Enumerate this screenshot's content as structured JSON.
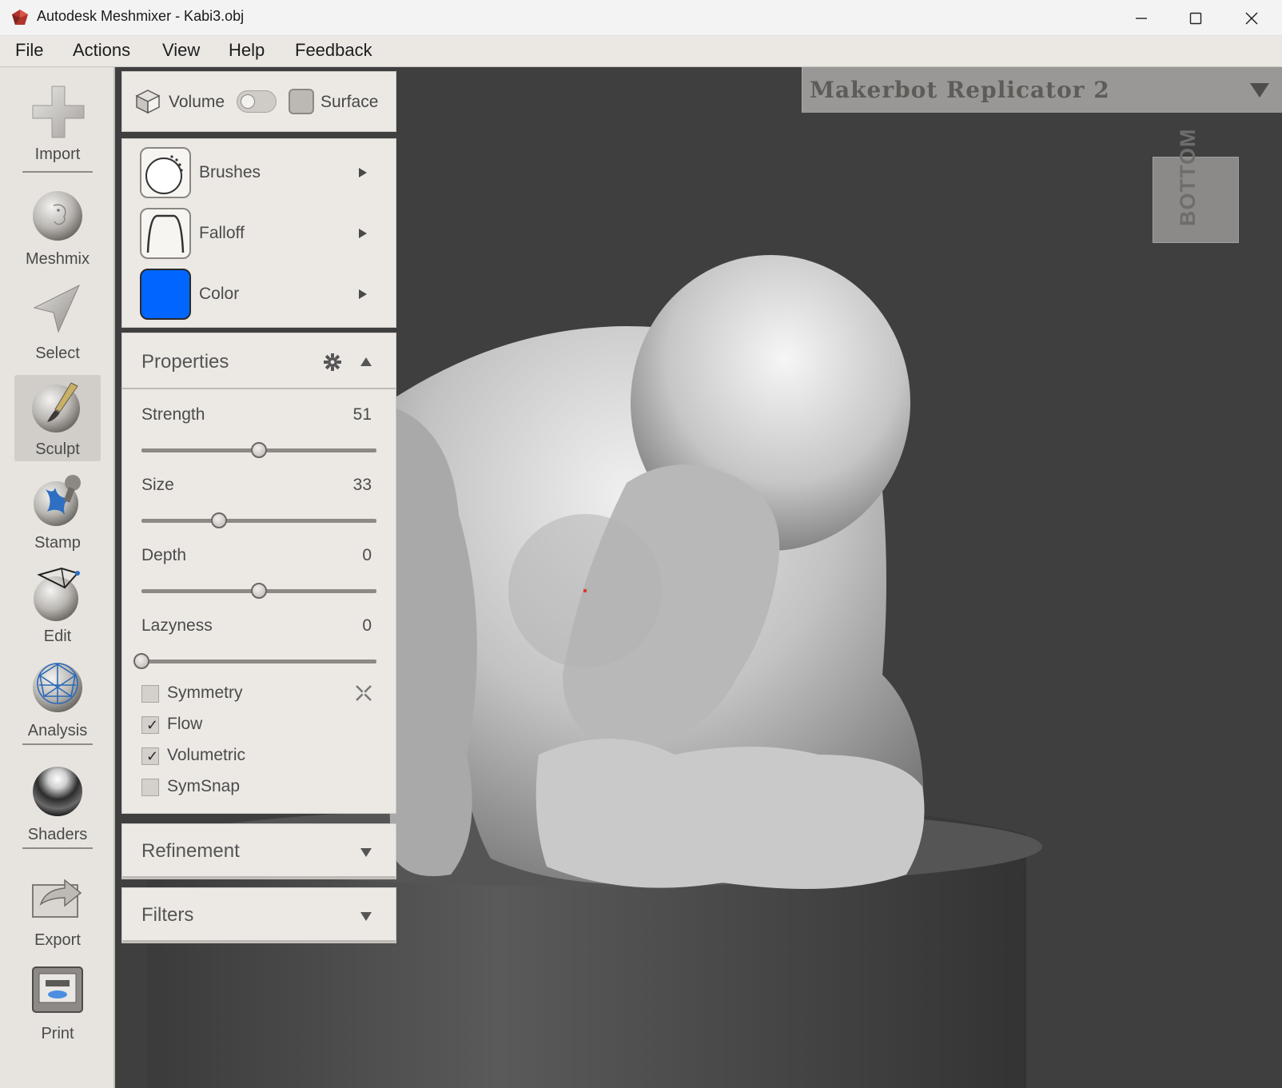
{
  "window": {
    "title": "Autodesk Meshmixer - Kabi3.obj",
    "controls": [
      "minimize-icon",
      "maximize-icon",
      "close-icon"
    ]
  },
  "menu": {
    "items": [
      {
        "label": "File"
      },
      {
        "label": "Actions"
      },
      {
        "label": "View"
      },
      {
        "label": "Help"
      },
      {
        "label": "Feedback"
      }
    ]
  },
  "toolbar": {
    "tools": [
      {
        "label": "Import",
        "icon": "plus-icon"
      },
      {
        "label": "Meshmix",
        "icon": "face-sphere-icon"
      },
      {
        "label": "Select",
        "icon": "arrow-pointer-icon"
      },
      {
        "label": "Sculpt",
        "icon": "brush-sphere-icon",
        "active": true
      },
      {
        "label": "Stamp",
        "icon": "stamp-icon"
      },
      {
        "label": "Edit",
        "icon": "edit-sphere-icon"
      },
      {
        "label": "Analysis",
        "icon": "mesh-sphere-icon"
      },
      {
        "label": "Shaders",
        "icon": "chrome-sphere-icon"
      },
      {
        "label": "Export",
        "icon": "export-arrow-icon"
      },
      {
        "label": "Print",
        "icon": "printer-icon"
      }
    ]
  },
  "viewport": {
    "printer": "Makerbot Replicator 2",
    "viewcube": "BOTTOM",
    "background_color": "#3f3f3f"
  },
  "sculpt": {
    "mode": {
      "volume_label": "Volume",
      "surface_label": "Surface"
    },
    "brushes": [
      {
        "label": "Brushes",
        "icon": "brush-circle-icon"
      },
      {
        "label": "Falloff",
        "icon": "falloff-curve-icon"
      },
      {
        "label": "Color",
        "icon": "color-swatch-icon",
        "color": "#0066ff"
      }
    ],
    "properties": {
      "title": "Properties",
      "sliders": [
        {
          "name": "Strength",
          "value": "51",
          "fraction": 0.5
        },
        {
          "name": "Size",
          "value": "33",
          "fraction": 0.33
        },
        {
          "name": "Depth",
          "value": "0",
          "fraction": 0.5
        },
        {
          "name": "Lazyness",
          "value": "0",
          "fraction": 0.0
        }
      ],
      "checkboxes": [
        {
          "label": "Symmetry",
          "checked": false
        },
        {
          "label": "Flow",
          "checked": true
        },
        {
          "label": "Volumetric",
          "checked": true
        },
        {
          "label": "SymSnap",
          "checked": false
        }
      ]
    },
    "sections": [
      {
        "title": "Refinement"
      },
      {
        "title": "Filters"
      }
    ]
  }
}
